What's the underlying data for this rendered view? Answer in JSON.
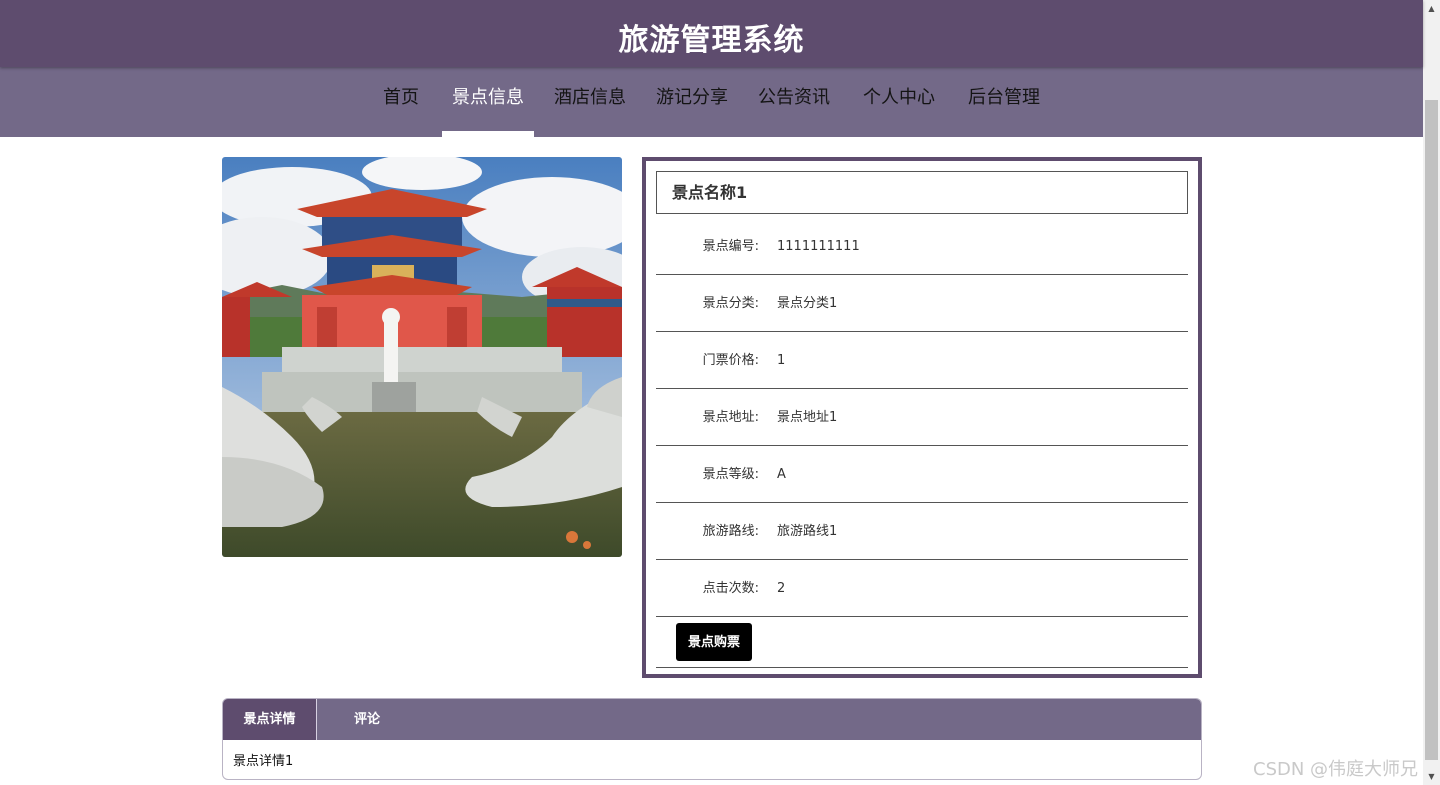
{
  "header": {
    "title": "旅游管理系统"
  },
  "nav": {
    "items": [
      {
        "label": "首页"
      },
      {
        "label": "景点信息"
      },
      {
        "label": "酒店信息"
      },
      {
        "label": "游记分享"
      },
      {
        "label": "公告资讯"
      },
      {
        "label": "个人中心"
      },
      {
        "label": "后台管理"
      }
    ],
    "active_index": 1
  },
  "attraction": {
    "name": "景点名称1",
    "fields": [
      {
        "label": "景点编号:",
        "value": "1111111111"
      },
      {
        "label": "景点分类:",
        "value": "景点分类1"
      },
      {
        "label": "门票价格:",
        "value": "1"
      },
      {
        "label": "景点地址:",
        "value": "景点地址1"
      },
      {
        "label": "景点等级:",
        "value": "A"
      },
      {
        "label": "旅游路线:",
        "value": "旅游路线1"
      },
      {
        "label": "点击次数:",
        "value": "2"
      }
    ],
    "buy_button": "景点购票"
  },
  "tabs": {
    "items": [
      {
        "label": "景点详情"
      },
      {
        "label": "评论"
      }
    ],
    "active_index": 0,
    "content": "景点详情1"
  },
  "watermark": "CSDN @伟庭大师兄",
  "colors": {
    "header_bg": "#5e4c6e",
    "nav_bg": "#736988",
    "accent_border": "#5e4c6e",
    "button_bg": "#000000"
  }
}
